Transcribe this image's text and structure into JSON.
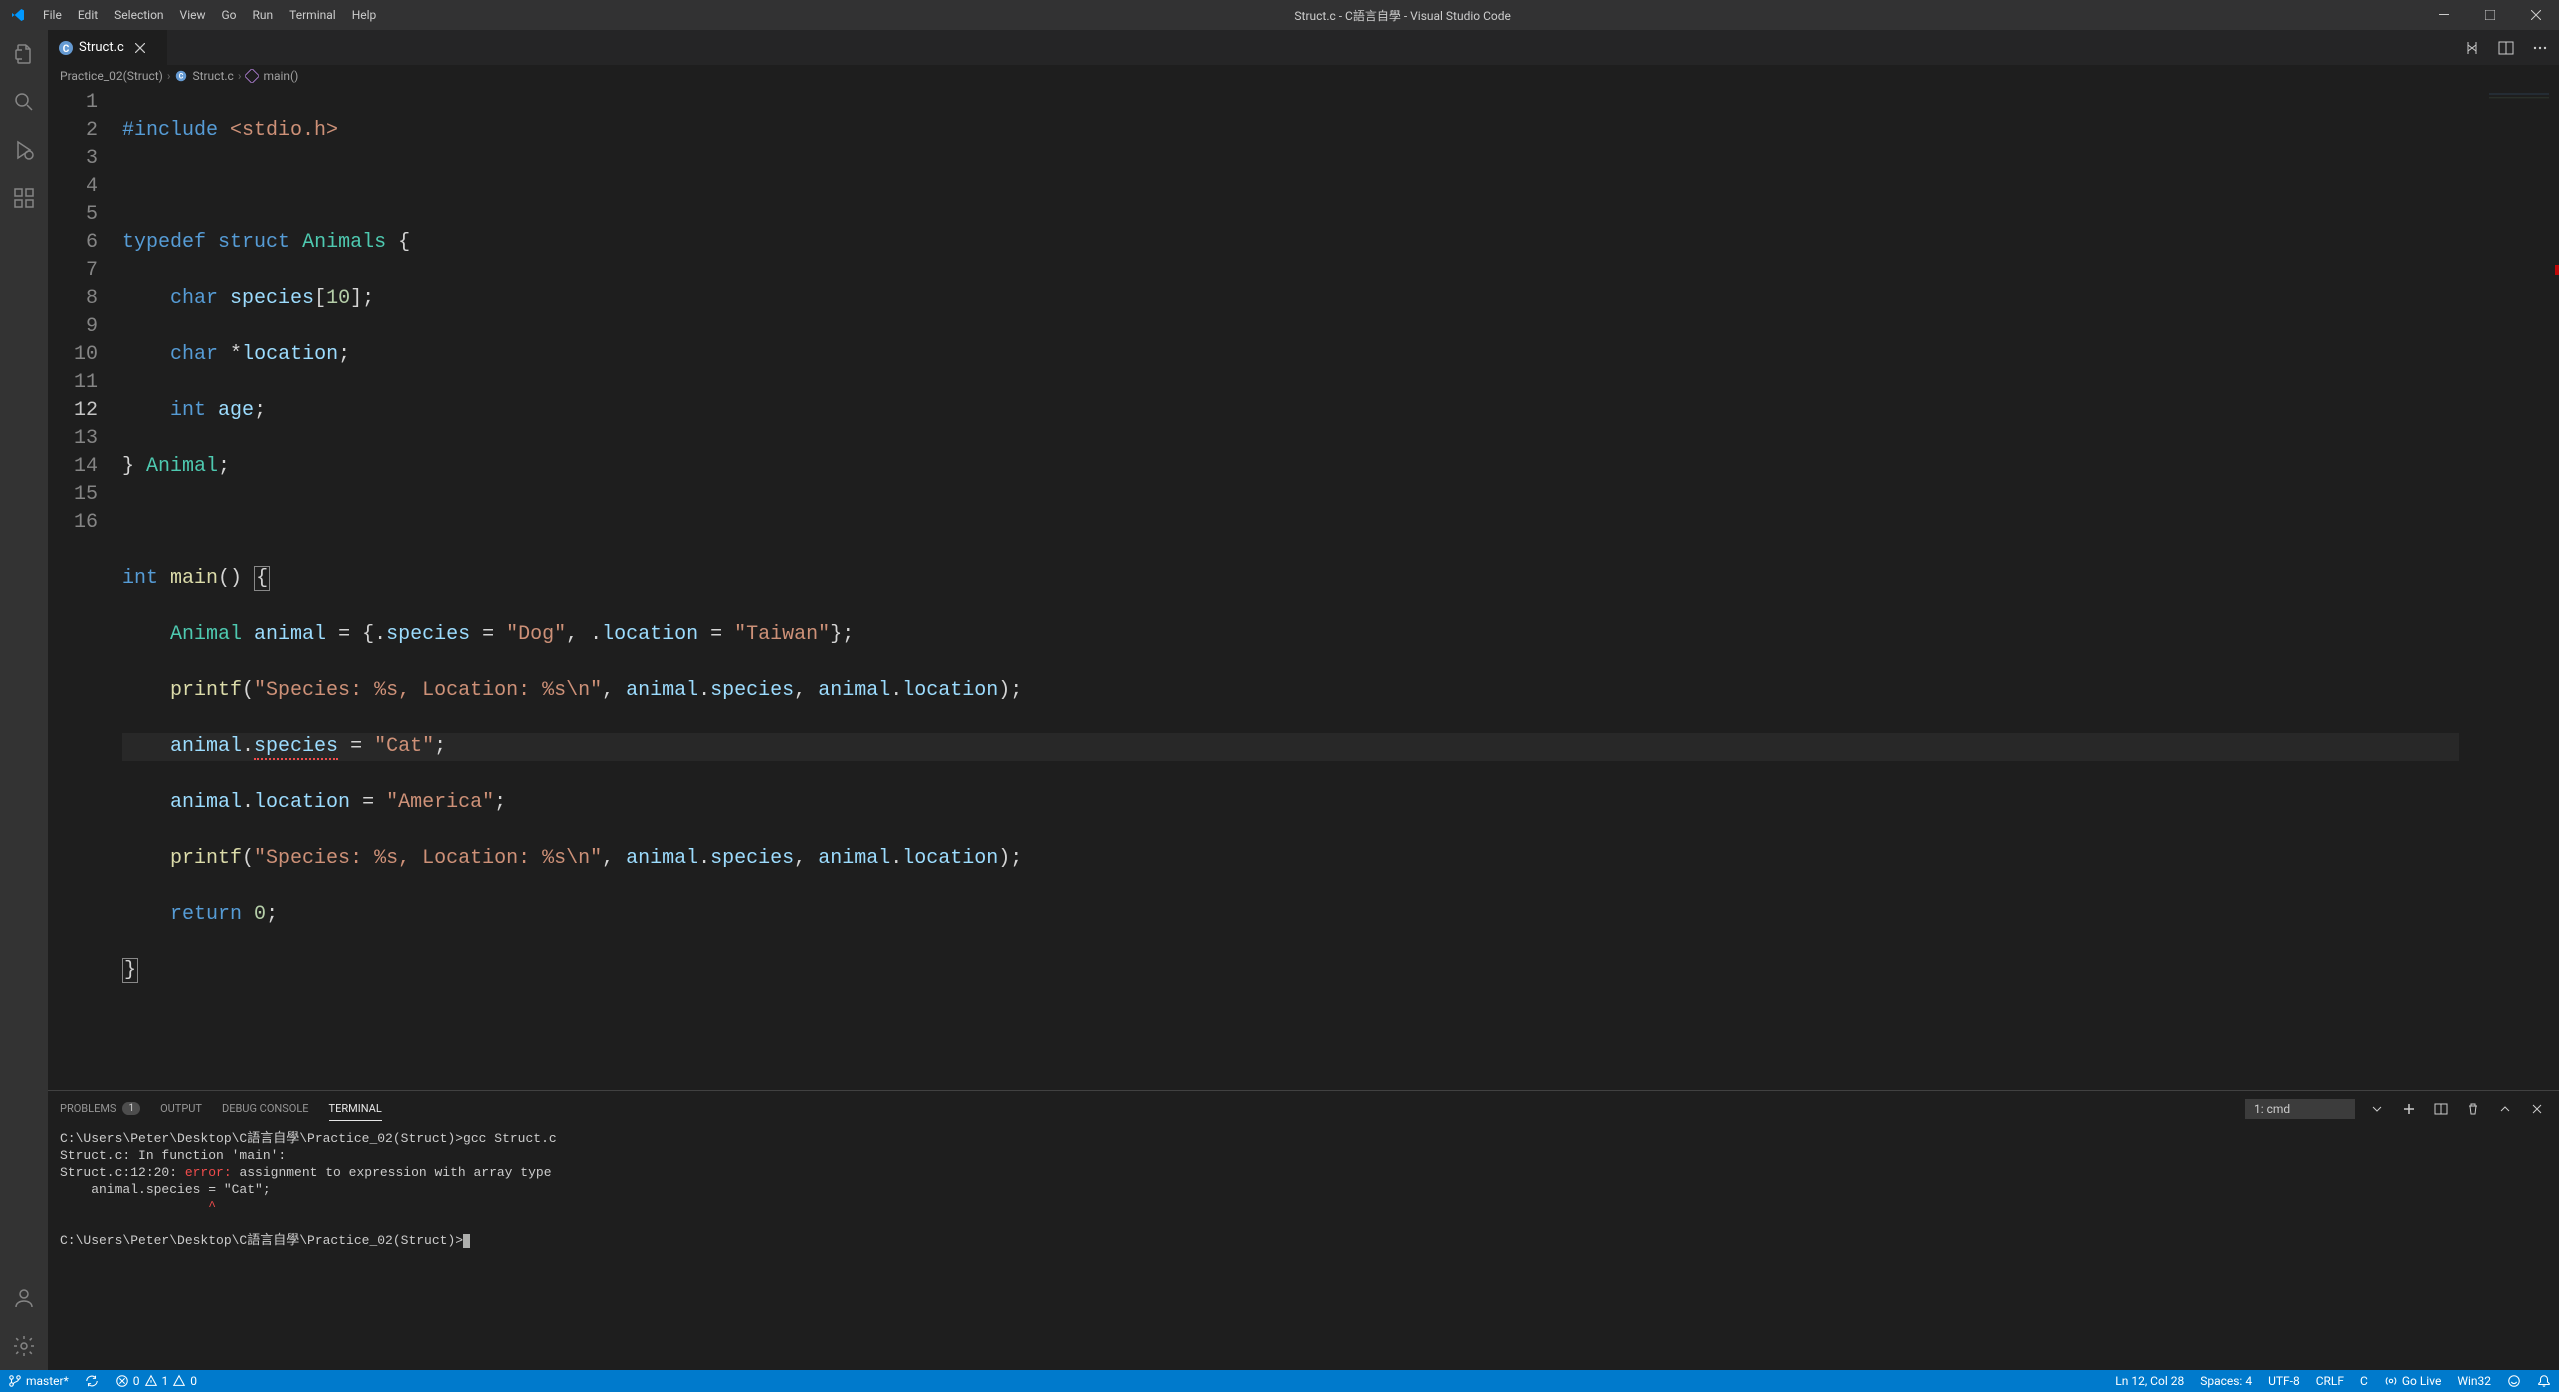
{
  "window": {
    "title": "Struct.c - C語言自學 - Visual Studio Code"
  },
  "menubar": [
    "File",
    "Edit",
    "Selection",
    "View",
    "Go",
    "Run",
    "Terminal",
    "Help"
  ],
  "tab": {
    "label": "Struct.c"
  },
  "breadcrumbs": {
    "items": [
      "Practice_02(Struct)",
      "Struct.c",
      "main()"
    ]
  },
  "editor": {
    "active_line": 12,
    "lines": 16
  },
  "code_tokens": {
    "l1": {
      "include": "#include",
      "lt": "<stdio.h>"
    },
    "l3": {
      "typedef": "typedef",
      "struct": "struct",
      "name": "Animals",
      "brace": "{"
    },
    "l4": {
      "char": "char",
      "id": "species",
      "arr": "[",
      "num": "10",
      "arrc": "]",
      "semi": ";"
    },
    "l5": {
      "char": "char",
      "star": "*",
      "id": "location",
      "semi": ";"
    },
    "l6": {
      "int": "int",
      "id": "age",
      "semi": ";"
    },
    "l7": {
      "brace": "}",
      "name": "Animal",
      "semi": ";"
    },
    "l9": {
      "int": "int",
      "main": "main",
      "paren": "()",
      "brace": "{"
    },
    "l10": {
      "type": "Animal",
      "var": "animal",
      "eq": " = {.",
      "f1": "species",
      "eq1": " = ",
      "s1": "\"Dog\"",
      "c1": ", .",
      "f2": "location",
      "eq2": " = ",
      "s2": "\"Taiwan\"",
      "end": "};"
    },
    "l11": {
      "fn": "printf",
      "open": "(",
      "str": "\"Species: %s, Location: %s\\n\"",
      "c1": ", ",
      "a1": "animal",
      "d1": ".",
      "p1": "species",
      "c2": ", ",
      "a2": "animal",
      "d2": ".",
      "p2": "location",
      "close": ");"
    },
    "l12": {
      "a": "animal",
      "d": ".",
      "p": "species",
      "eq": " = ",
      "s": "\"Cat\"",
      "semi": ";"
    },
    "l13": {
      "a": "animal",
      "d": ".",
      "p": "location",
      "eq": " = ",
      "s": "\"America\"",
      "semi": ";"
    },
    "l14": {
      "fn": "printf",
      "open": "(",
      "str": "\"Species: %s, Location: %s\\n\"",
      "c1": ", ",
      "a1": "animal",
      "d1": ".",
      "p1": "species",
      "c2": ", ",
      "a2": "animal",
      "d2": ".",
      "p2": "location",
      "close": ");"
    },
    "l15": {
      "ret": "return",
      "num": "0",
      "semi": ";"
    },
    "l16": {
      "brace": "}"
    }
  },
  "panel": {
    "tabs": {
      "problems": "PROBLEMS",
      "problems_badge": "1",
      "output": "OUTPUT",
      "debug": "DEBUG CONSOLE",
      "terminal": "TERMINAL"
    },
    "terminal_selector": "1: cmd"
  },
  "terminal": {
    "line1": "C:\\Users\\Peter\\Desktop\\C語言自學\\Practice_02(Struct)>gcc Struct.c",
    "line2": "Struct.c: In function 'main':",
    "line3_pre": "Struct.c:12:20: ",
    "line3_err": "error:",
    "line3_post": " assignment to expression with array type",
    "line4": "    animal.species = \"Cat\";",
    "line5": "                   ^",
    "prompt": "C:\\Users\\Peter\\Desktop\\C語言自學\\Practice_02(Struct)>"
  },
  "statusbar": {
    "branch": "master*",
    "errors": "0",
    "warnings": "1",
    "info": "0",
    "cursor": "Ln 12, Col 28",
    "spaces": "Spaces: 4",
    "encoding": "UTF-8",
    "eol": "CRLF",
    "lang": "C",
    "golive": "Go Live",
    "platform": "Win32"
  }
}
